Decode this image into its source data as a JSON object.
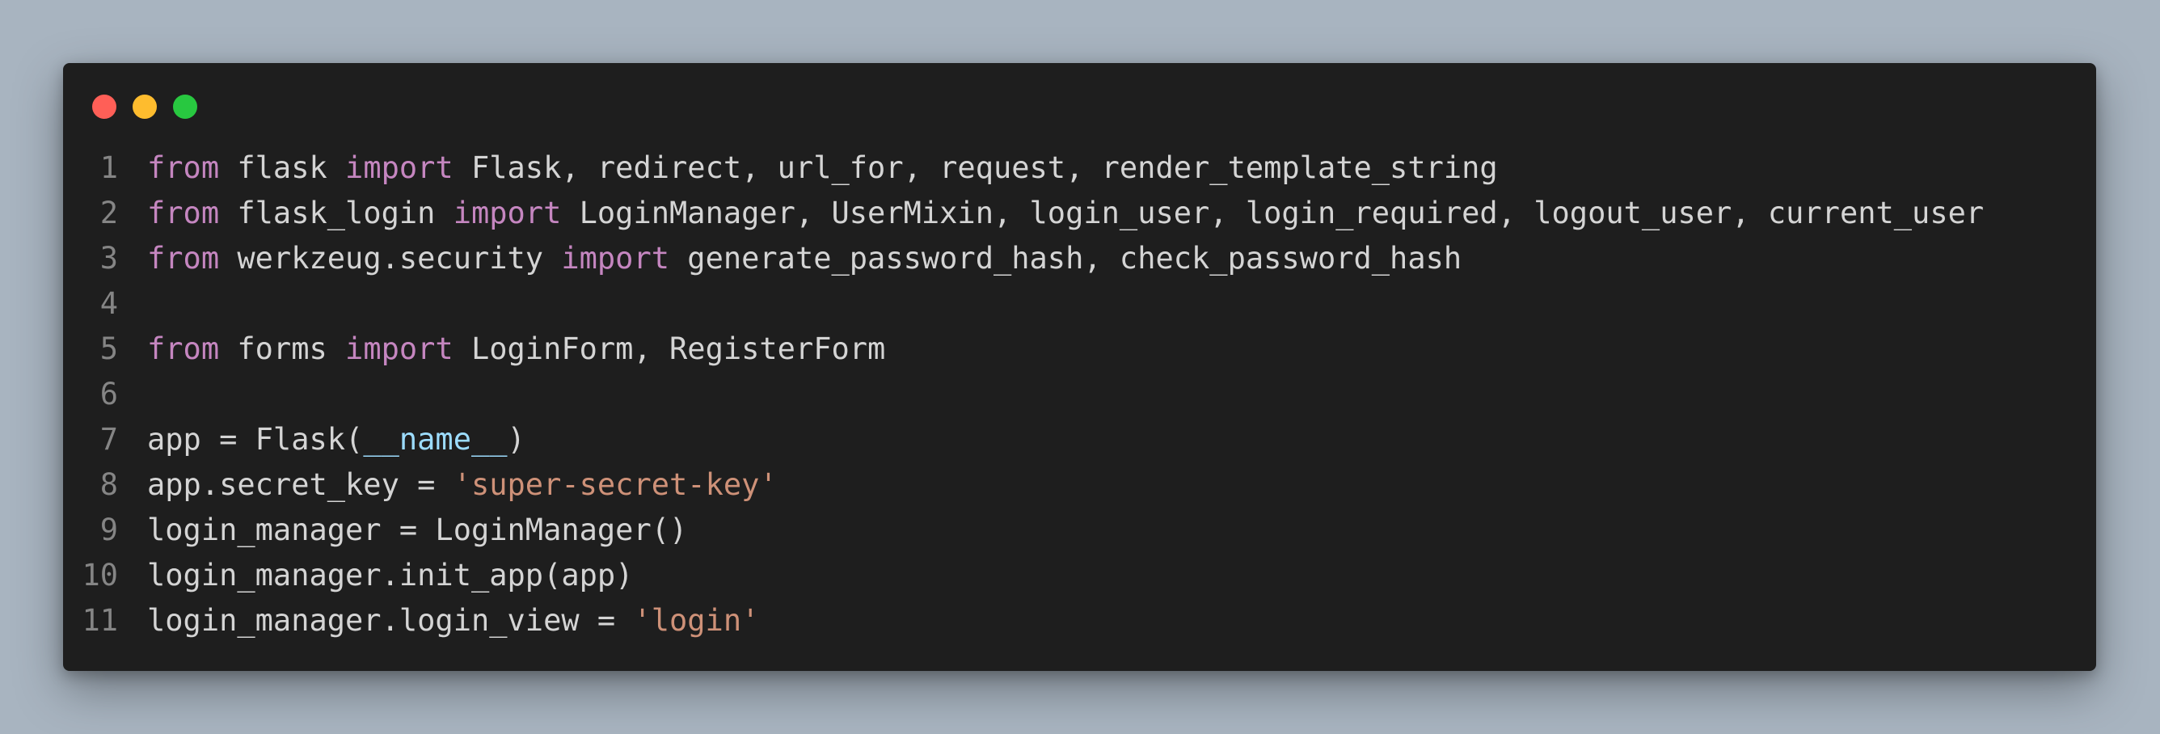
{
  "window": {
    "controls": [
      {
        "name": "close",
        "color": "#ff5f57"
      },
      {
        "name": "minimize",
        "color": "#febc2e"
      },
      {
        "name": "zoom",
        "color": "#28c840"
      }
    ]
  },
  "theme": {
    "background": "#1e1e1e",
    "text": "#d4d4d4",
    "keyword": "#c586c0",
    "string": "#ce9178",
    "variable": "#9cdcfe",
    "line_number": "#858585"
  },
  "code": {
    "lines": [
      {
        "num": "1",
        "tokens": [
          {
            "t": "from",
            "c": "kw"
          },
          {
            "t": " flask ",
            "c": "plain"
          },
          {
            "t": "import",
            "c": "kw"
          },
          {
            "t": " Flask, redirect, url_for, request, render_template_string",
            "c": "plain"
          }
        ]
      },
      {
        "num": "2",
        "tokens": [
          {
            "t": "from",
            "c": "kw"
          },
          {
            "t": " flask_login ",
            "c": "plain"
          },
          {
            "t": "import",
            "c": "kw"
          },
          {
            "t": " LoginManager, UserMixin, login_user, login_required, logout_user, current_user",
            "c": "plain"
          }
        ]
      },
      {
        "num": "3",
        "tokens": [
          {
            "t": "from",
            "c": "kw"
          },
          {
            "t": " werkzeug.security ",
            "c": "plain"
          },
          {
            "t": "import",
            "c": "kw"
          },
          {
            "t": " generate_password_hash, check_password_hash",
            "c": "plain"
          }
        ]
      },
      {
        "num": "4",
        "tokens": []
      },
      {
        "num": "5",
        "tokens": [
          {
            "t": "from",
            "c": "kw"
          },
          {
            "t": " forms ",
            "c": "plain"
          },
          {
            "t": "import",
            "c": "kw"
          },
          {
            "t": " LoginForm, RegisterForm",
            "c": "plain"
          }
        ]
      },
      {
        "num": "6",
        "tokens": []
      },
      {
        "num": "7",
        "tokens": [
          {
            "t": "app = Flask(",
            "c": "plain"
          },
          {
            "t": "__name__",
            "c": "var"
          },
          {
            "t": ")",
            "c": "plain"
          }
        ]
      },
      {
        "num": "8",
        "tokens": [
          {
            "t": "app.secret_key = ",
            "c": "plain"
          },
          {
            "t": "'super-secret-key'",
            "c": "str"
          }
        ]
      },
      {
        "num": "9",
        "tokens": [
          {
            "t": "login_manager = LoginManager()",
            "c": "plain"
          }
        ]
      },
      {
        "num": "10",
        "tokens": [
          {
            "t": "login_manager.init_app(app)",
            "c": "plain"
          }
        ]
      },
      {
        "num": "11",
        "tokens": [
          {
            "t": "login_manager.login_view = ",
            "c": "plain"
          },
          {
            "t": "'login'",
            "c": "str"
          }
        ]
      }
    ]
  }
}
